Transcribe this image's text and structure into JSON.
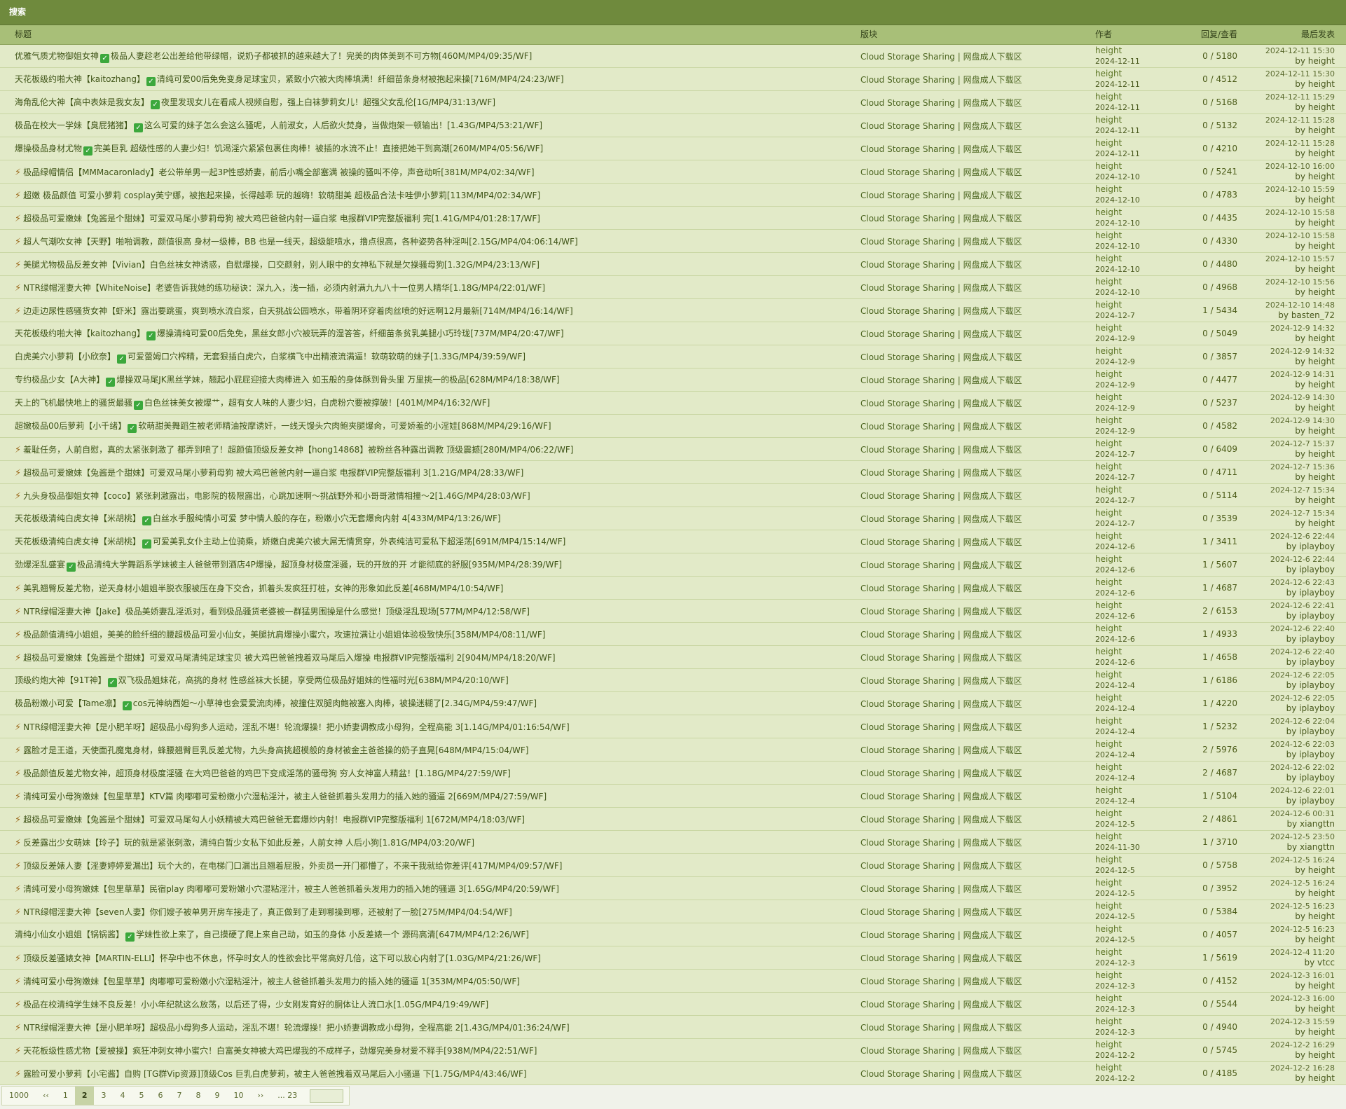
{
  "window_title": "搜索",
  "columns": {
    "title": "标题",
    "forum": "版块",
    "author": "作者",
    "stats": "回复/查看",
    "last": "最后发表"
  },
  "rows": [
    {
      "icon": "check",
      "prefix": "优雅气质尤物御姐女神",
      "title": "极品人妻趁老公出差给他带绿帽，说奶子都被抓的越来越大了！完美的肉体美到不可方物[460M/MP4/09:35/WF]",
      "forum": "Cloud Storage Sharing | 网盘成人下载区",
      "author": "height",
      "author_date": "2024-12-11",
      "stats": "0 / 5180",
      "last_date": "2024-12-11 15:30",
      "last_by": "by height"
    },
    {
      "icon": "check",
      "prefix": "天花板级约啪大神【kaitozhang】",
      "title": "清纯可爱00后免免变身足球宝贝，紧致小穴被大肉棒填满！纤细苗条身材被抱起来操[716M/MP4/24:23/WF]",
      "forum": "Cloud Storage Sharing | 网盘成人下载区",
      "author": "height",
      "author_date": "2024-12-11",
      "stats": "0 / 4512",
      "last_date": "2024-12-11 15:30",
      "last_by": "by height"
    },
    {
      "icon": "check",
      "prefix": "海角乱伦大神【高中表妹是我女友】",
      "title": "夜里发现女儿在看成人视频自慰，强上白袜萝莉女儿！超强父女乱伦[1G/MP4/31:13/WF]",
      "forum": "Cloud Storage Sharing | 网盘成人下载区",
      "author": "height",
      "author_date": "2024-12-11",
      "stats": "0 / 5168",
      "last_date": "2024-12-11 15:29",
      "last_by": "by height"
    },
    {
      "icon": "check",
      "prefix": "极品在校大一学妹【臭屁猪猪】",
      "title": "这么可爱的妹子怎么会这么骚呢，人前淑女，人后欲火焚身，当做炮架一顿输出！[1.43G/MP4/53:21/WF]",
      "forum": "Cloud Storage Sharing | 网盘成人下载区",
      "author": "height",
      "author_date": "2024-12-11",
      "stats": "0 / 5132",
      "last_date": "2024-12-11 15:28",
      "last_by": "by height"
    },
    {
      "icon": "check",
      "prefix": "爆操极品身材尤物",
      "title": "完美巨乳 超级性感的人妻少妇！饥渴淫穴紧紧包裹住肉棒！被插的水流不止！直接把她干到高潮[260M/MP4/05:56/WF]",
      "forum": "Cloud Storage Sharing | 网盘成人下载区",
      "author": "height",
      "author_date": "2024-12-11",
      "stats": "0 / 4210",
      "last_date": "2024-12-11 15:28",
      "last_by": "by height"
    },
    {
      "icon": "bolt",
      "prefix": "",
      "title": "极品绿帽情侣【MMMacaronlady】老公带单男一起3P性感娇妻，前后小嘴全部塞满 被操的骚叫不停，声音动听[381M/MP4/02:34/WF]",
      "forum": "Cloud Storage Sharing | 网盘成人下载区",
      "author": "height",
      "author_date": "2024-12-10",
      "stats": "0 / 5241",
      "last_date": "2024-12-10 16:00",
      "last_by": "by height"
    },
    {
      "icon": "bolt",
      "prefix": "",
      "title": "超嫩 极品颜值 可爱小萝莉 cosplay芙宁娜，被抱起来操，长得越乖 玩的越嗨！软萌甜美 超极品合法卡哇伊小萝莉[113M/MP4/02:34/WF]",
      "forum": "Cloud Storage Sharing | 网盘成人下载区",
      "author": "height",
      "author_date": "2024-12-10",
      "stats": "0 / 4783",
      "last_date": "2024-12-10 15:59",
      "last_by": "by height"
    },
    {
      "icon": "bolt",
      "prefix": "",
      "title": "超极品可爱嫩妹【兔酱是个甜妹】可爱双马尾小萝莉母狗 被大鸡巴爸爸内射一逼白浆 电报群VIP完整版福利 完[1.41G/MP4/01:28:17/WF]",
      "forum": "Cloud Storage Sharing | 网盘成人下载区",
      "author": "height",
      "author_date": "2024-12-10",
      "stats": "0 / 4435",
      "last_date": "2024-12-10 15:58",
      "last_by": "by height"
    },
    {
      "icon": "bolt",
      "prefix": "",
      "title": "超人气潮吹女神【天野】啪啪调教，颜值很高 身材一级棒，BB 也是一线天，超级能喷水，撸点很高，各种姿势各种淫叫[2.15G/MP4/04:06:14/WF]",
      "forum": "Cloud Storage Sharing | 网盘成人下载区",
      "author": "height",
      "author_date": "2024-12-10",
      "stats": "0 / 4330",
      "last_date": "2024-12-10 15:58",
      "last_by": "by height"
    },
    {
      "icon": "bolt",
      "prefix": "",
      "title": "美腿尤物极品反差女神【Vivian】白色丝袜女神诱惑，自慰爆操，口交颜射，别人眼中的女神私下就是欠操骚母狗[1.32G/MP4/23:13/WF]",
      "forum": "Cloud Storage Sharing | 网盘成人下载区",
      "author": "height",
      "author_date": "2024-12-10",
      "stats": "0 / 4480",
      "last_date": "2024-12-10 15:57",
      "last_by": "by height"
    },
    {
      "icon": "bolt",
      "prefix": "",
      "title": "NTR绿帽淫妻大神【WhiteNoise】老婆告诉我她的练功秘诀：深九入，浅一插，必须内射满九九八十一位男人精华[1.18G/MP4/22:01/WF]",
      "forum": "Cloud Storage Sharing | 网盘成人下载区",
      "author": "height",
      "author_date": "2024-12-10",
      "stats": "0 / 4968",
      "last_date": "2024-12-10 15:56",
      "last_by": "by height"
    },
    {
      "icon": "bolt",
      "prefix": "",
      "title": "边走边尿性感骚货女神【虾米】露出要跳蛋，爽到喷水流白浆，白天挑战公园喷水，带着阴环穿着肉丝喷的好远啊12月最新[714M/MP4/16:14/WF]",
      "forum": "Cloud Storage Sharing | 网盘成人下载区",
      "author": "height",
      "author_date": "2024-12-7",
      "stats": "1 / 5434",
      "last_date": "2024-12-10 14:48",
      "last_by": "by basten_72"
    },
    {
      "icon": "check",
      "prefix": "天花板级约啪大神【kaitozhang】",
      "title": "爆操清纯可爱00后免免，黑丝女郎小穴被玩弄的湿答答，纤细苗条贫乳美腿小巧玲珑[737M/MP4/20:47/WF]",
      "forum": "Cloud Storage Sharing | 网盘成人下载区",
      "author": "height",
      "author_date": "2024-12-9",
      "stats": "0 / 5049",
      "last_date": "2024-12-9 14:32",
      "last_by": "by height"
    },
    {
      "icon": "check",
      "prefix": "白虎美穴小萝莉【小欣奈】",
      "title": "可爱蕾姆口穴榨精，无套狠插白虎穴，白浆横飞中出精液流满逼！软萌软萌的妹子[1.33G/MP4/39:59/WF]",
      "forum": "Cloud Storage Sharing | 网盘成人下载区",
      "author": "height",
      "author_date": "2024-12-9",
      "stats": "0 / 3857",
      "last_date": "2024-12-9 14:32",
      "last_by": "by height"
    },
    {
      "icon": "check",
      "prefix": "专约极品少女【A大神】",
      "title": "爆操双马尾JK黑丝学妹，翘起小屁屁迎接大肉棒进入 如玉般的身体酥到骨头里 万里挑一的极品[628M/MP4/18:38/WF]",
      "forum": "Cloud Storage Sharing | 网盘成人下载区",
      "author": "height",
      "author_date": "2024-12-9",
      "stats": "0 / 4477",
      "last_date": "2024-12-9 14:31",
      "last_by": "by height"
    },
    {
      "icon": "check",
      "prefix": "天上的飞机最快地上的骚货最骚",
      "title": "白色丝袜美女被爆艹，超有女人味的人妻少妇，白虎粉穴要被撑破！[401M/MP4/16:32/WF]",
      "forum": "Cloud Storage Sharing | 网盘成人下载区",
      "author": "height",
      "author_date": "2024-12-9",
      "stats": "0 / 5237",
      "last_date": "2024-12-9 14:30",
      "last_by": "by height"
    },
    {
      "icon": "check",
      "prefix": "超嫩极品00后萝莉【小千绪】",
      "title": "软萌甜美舞蹈生被老师精油按摩诱奸，一线天馒头穴肉鲍夹腿爆肏，可爱娇羞的小淫娃[868M/MP4/29:16/WF]",
      "forum": "Cloud Storage Sharing | 网盘成人下载区",
      "author": "height",
      "author_date": "2024-12-9",
      "stats": "0 / 4582",
      "last_date": "2024-12-9 14:30",
      "last_by": "by height"
    },
    {
      "icon": "bolt",
      "prefix": "",
      "title": "羞耻任务，人前自慰，真的太紧张刺激了 都弄到喷了！超颜值顶级反差女神【hong14868】被粉丝各种露出调教 顶级震撼[280M/MP4/06:22/WF]",
      "forum": "Cloud Storage Sharing | 网盘成人下载区",
      "author": "height",
      "author_date": "2024-12-7",
      "stats": "0 / 6409",
      "last_date": "2024-12-7 15:37",
      "last_by": "by height"
    },
    {
      "icon": "bolt",
      "prefix": "",
      "title": "超极品可爱嫩妹【兔酱是个甜妹】可爱双马尾小萝莉母狗 被大鸡巴爸爸内射一逼白浆 电报群VIP完整版福利 3[1.21G/MP4/28:33/WF]",
      "forum": "Cloud Storage Sharing | 网盘成人下载区",
      "author": "height",
      "author_date": "2024-12-7",
      "stats": "0 / 4711",
      "last_date": "2024-12-7 15:36",
      "last_by": "by height"
    },
    {
      "icon": "bolt",
      "prefix": "",
      "title": "九头身极品御姐女神【coco】紧张刺激露出，电影院的极限露出，心跳加速啊～挑战野外和小哥哥激情相撞～2[1.46G/MP4/28:03/WF]",
      "forum": "Cloud Storage Sharing | 网盘成人下载区",
      "author": "height",
      "author_date": "2024-12-7",
      "stats": "0 / 5114",
      "last_date": "2024-12-7 15:34",
      "last_by": "by height"
    },
    {
      "icon": "check",
      "prefix": "天花板级清纯白虎女神【米胡桃】",
      "title": "白丝水手服纯情小可爱 梦中情人般的存在，粉嫩小穴无套爆肏内射 4[433M/MP4/13:26/WF]",
      "forum": "Cloud Storage Sharing | 网盘成人下载区",
      "author": "height",
      "author_date": "2024-12-7",
      "stats": "0 / 3539",
      "last_date": "2024-12-7 15:34",
      "last_by": "by height"
    },
    {
      "icon": "check",
      "prefix": "天花板级清纯白虎女神【米胡桃】",
      "title": "可爱美乳女仆主动上位骑乘，娇嫩白虎美穴被大屌无情贯穿，外表纯洁可爱私下超淫荡[691M/MP4/15:14/WF]",
      "forum": "Cloud Storage Sharing | 网盘成人下载区",
      "author": "height",
      "author_date": "2024-12-6",
      "stats": "1 / 3411",
      "last_date": "2024-12-6 22:44",
      "last_by": "by iplayboy"
    },
    {
      "icon": "check",
      "prefix": "劲爆淫乱盛宴",
      "title": "极品清纯大学舞蹈系学妹被主人爸爸带到酒店4P爆操，超顶身材极度淫骚，玩的开放的开 才能彻底的舒服[935M/MP4/28:39/WF]",
      "forum": "Cloud Storage Sharing | 网盘成人下载区",
      "author": "height",
      "author_date": "2024-12-6",
      "stats": "1 / 5607",
      "last_date": "2024-12-6 22:44",
      "last_by": "by iplayboy"
    },
    {
      "icon": "bolt",
      "prefix": "",
      "title": "美乳翘臀反差尤物，逆天身材小姐姐半脱衣服被压在身下交合，抓着头发疯狂打桩，女神的形象如此反差[468M/MP4/10:54/WF]",
      "forum": "Cloud Storage Sharing | 网盘成人下载区",
      "author": "height",
      "author_date": "2024-12-6",
      "stats": "1 / 4687",
      "last_date": "2024-12-6 22:43",
      "last_by": "by iplayboy"
    },
    {
      "icon": "bolt",
      "prefix": "",
      "title": "NTR绿帽淫妻大神【Jake】极品美娇妻乱淫派对，看到极品骚货老婆被一群猛男围操是什么感觉！顶级淫乱现场[577M/MP4/12:58/WF]",
      "forum": "Cloud Storage Sharing | 网盘成人下载区",
      "author": "height",
      "author_date": "2024-12-6",
      "stats": "2 / 6153",
      "last_date": "2024-12-6 22:41",
      "last_by": "by iplayboy"
    },
    {
      "icon": "bolt",
      "prefix": "",
      "title": "极品颜值清纯小姐姐，美美的脸纤细的腰超极品可爱小仙女，美腿抗肩爆操小蜜穴，攻速拉满让小姐姐体验极致快乐[358M/MP4/08:11/WF]",
      "forum": "Cloud Storage Sharing | 网盘成人下载区",
      "author": "height",
      "author_date": "2024-12-6",
      "stats": "1 / 4933",
      "last_date": "2024-12-6 22:40",
      "last_by": "by iplayboy"
    },
    {
      "icon": "bolt",
      "prefix": "",
      "title": "超极品可爱嫩妹【兔酱是个甜妹】可爱双马尾清纯足球宝贝 被大鸡巴爸爸拽着双马尾后入爆操 电报群VIP完整版福利 2[904M/MP4/18:20/WF]",
      "forum": "Cloud Storage Sharing | 网盘成人下载区",
      "author": "height",
      "author_date": "2024-12-6",
      "stats": "1 / 4658",
      "last_date": "2024-12-6 22:40",
      "last_by": "by iplayboy"
    },
    {
      "icon": "check",
      "prefix": "顶级约炮大神【91T神】",
      "title": "双飞极品姐妹花，高挑的身材 性感丝袜大长腿，享受两位极品好姐妹的性福时光[638M/MP4/20:10/WF]",
      "forum": "Cloud Storage Sharing | 网盘成人下载区",
      "author": "height",
      "author_date": "2024-12-4",
      "stats": "1 / 6186",
      "last_date": "2024-12-6 22:05",
      "last_by": "by iplayboy"
    },
    {
      "icon": "check",
      "prefix": "极品粉嫩小可爱【Tame凛】",
      "title": "cos元神纳西妲～小草神也会爱爱流肉棒，被撞住双腿肉鲍被塞入肉棒，被操迷糊了[2.34G/MP4/59:47/WF]",
      "forum": "Cloud Storage Sharing | 网盘成人下载区",
      "author": "height",
      "author_date": "2024-12-4",
      "stats": "1 / 4220",
      "last_date": "2024-12-6 22:05",
      "last_by": "by iplayboy"
    },
    {
      "icon": "bolt",
      "prefix": "",
      "title": "NTR绿帽淫妻大神【是小肥羊呀】超极品小母狗多人运动，淫乱不堪！轮流爆操！把小娇妻调教成小母狗，全程高能 3[1.14G/MP4/01:16:54/WF]",
      "forum": "Cloud Storage Sharing | 网盘成人下载区",
      "author": "height",
      "author_date": "2024-12-4",
      "stats": "1 / 5232",
      "last_date": "2024-12-6 22:04",
      "last_by": "by iplayboy"
    },
    {
      "icon": "bolt",
      "prefix": "",
      "title": "露脸才是王道，天使面孔魔鬼身材，蜂腰翘臀巨乳反差尤物，九头身高挑超模般的身材被金主爸爸操的奶子直晃[648M/MP4/15:04/WF]",
      "forum": "Cloud Storage Sharing | 网盘成人下载区",
      "author": "height",
      "author_date": "2024-12-4",
      "stats": "2 / 5976",
      "last_date": "2024-12-6 22:03",
      "last_by": "by iplayboy"
    },
    {
      "icon": "bolt",
      "prefix": "",
      "title": "极品颜值反差尤物女神，超顶身材极度淫骚 在大鸡巴爸爸的鸡巴下变成淫荡的骚母狗 穷人女神富人精盆！[1.18G/MP4/27:59/WF]",
      "forum": "Cloud Storage Sharing | 网盘成人下载区",
      "author": "height",
      "author_date": "2024-12-4",
      "stats": "2 / 4687",
      "last_date": "2024-12-6 22:02",
      "last_by": "by iplayboy"
    },
    {
      "icon": "bolt",
      "prefix": "",
      "title": "清纯可爱小母狗嫩妹【包里草草】KTV篇 肉嘟嘟可爱粉嫩小穴湿粘淫汁，被主人爸爸抓着头发用力的插入她的骚逼 2[669M/MP4/27:59/WF]",
      "forum": "Cloud Storage Sharing | 网盘成人下载区",
      "author": "height",
      "author_date": "2024-12-4",
      "stats": "1 / 5104",
      "last_date": "2024-12-6 22:01",
      "last_by": "by iplayboy"
    },
    {
      "icon": "bolt",
      "prefix": "",
      "title": "超极品可爱嫩妹【兔酱是个甜妹】可爱双马尾勾人小妖精被大鸡巴爸爸无套爆炒内射！电报群VIP完整版福利 1[672M/MP4/18:03/WF]",
      "forum": "Cloud Storage Sharing | 网盘成人下载区",
      "author": "height",
      "author_date": "2024-12-5",
      "stats": "2 / 4861",
      "last_date": "2024-12-6 00:31",
      "last_by": "by xiangttn"
    },
    {
      "icon": "bolt",
      "prefix": "",
      "title": "反差露出少女萌妹【玲子】玩的就是紧张刺激，清纯白皙少女私下如此反差，人前女神 人后小狗[1.81G/MP4/03:20/WF]",
      "forum": "Cloud Storage Sharing | 网盘成人下载区",
      "author": "height",
      "author_date": "2024-11-30",
      "stats": "1 / 3710",
      "last_date": "2024-12-5 23:50",
      "last_by": "by xiangttn"
    },
    {
      "icon": "bolt",
      "prefix": "",
      "title": "顶级反差婊人妻【淫妻婷婷爱漏出】玩个大的，在电梯门口漏出且翘着屁股，外卖员一开门都懵了，不来干我就给你差评[417M/MP4/09:57/WF]",
      "forum": "Cloud Storage Sharing | 网盘成人下载区",
      "author": "height",
      "author_date": "2024-12-5",
      "stats": "0 / 5758",
      "last_date": "2024-12-5 16:24",
      "last_by": "by height"
    },
    {
      "icon": "bolt",
      "prefix": "",
      "title": "清纯可爱小母狗嫩妹【包里草草】民宿play 肉嘟嘟可爱粉嫩小穴湿粘淫汁，被主人爸爸抓着头发用力的插入她的骚逼 3[1.65G/MP4/20:59/WF]",
      "forum": "Cloud Storage Sharing | 网盘成人下载区",
      "author": "height",
      "author_date": "2024-12-5",
      "stats": "0 / 3952",
      "last_date": "2024-12-5 16:24",
      "last_by": "by height"
    },
    {
      "icon": "bolt",
      "prefix": "",
      "title": "NTR绿帽淫妻大神【seven人妻】你们嫂子被单男开房车接走了，真正做到了走到哪操到哪，还被射了一脸[275M/MP4/04:54/WF]",
      "forum": "Cloud Storage Sharing | 网盘成人下载区",
      "author": "height",
      "author_date": "2024-12-5",
      "stats": "0 / 5384",
      "last_date": "2024-12-5 16:23",
      "last_by": "by height"
    },
    {
      "icon": "check",
      "prefix": "清纯小仙女小姐姐【锅锅酱】",
      "title": "学妹性欲上来了，自己摸硬了爬上来自己动，如玉的身体 小反差婊一个 源码高清[647M/MP4/12:26/WF]",
      "forum": "Cloud Storage Sharing | 网盘成人下载区",
      "author": "height",
      "author_date": "2024-12-5",
      "stats": "0 / 4057",
      "last_date": "2024-12-5 16:23",
      "last_by": "by height"
    },
    {
      "icon": "bolt",
      "prefix": "",
      "title": "顶级反差骚婊女神【MARTIN-ELLI】怀孕中也不休息，怀孕时女人的性欲会比平常高好几倍，这下可以放心内射了[1.03G/MP4/21:26/WF]",
      "forum": "Cloud Storage Sharing | 网盘成人下载区",
      "author": "height",
      "author_date": "2024-12-3",
      "stats": "1 / 5619",
      "last_date": "2024-12-4 11:20",
      "last_by": "by vtcc"
    },
    {
      "icon": "bolt",
      "prefix": "",
      "title": "清纯可爱小母狗嫩妹【包里草草】肉嘟嘟可爱粉嫩小穴湿粘淫汁，被主人爸爸抓着头发用力的插入她的骚逼 1[353M/MP4/05:50/WF]",
      "forum": "Cloud Storage Sharing | 网盘成人下载区",
      "author": "height",
      "author_date": "2024-12-3",
      "stats": "0 / 4152",
      "last_date": "2024-12-3 16:01",
      "last_by": "by height"
    },
    {
      "icon": "bolt",
      "prefix": "",
      "title": "极品在校清纯学生妹不良反差！小小年纪就这么放荡，以后还了得，少女刚发育好的胴体让人流口水[1.05G/MP4/19:49/WF]",
      "forum": "Cloud Storage Sharing | 网盘成人下载区",
      "author": "height",
      "author_date": "2024-12-3",
      "stats": "0 / 5544",
      "last_date": "2024-12-3 16:00",
      "last_by": "by height"
    },
    {
      "icon": "bolt",
      "prefix": "",
      "title": "NTR绿帽淫妻大神【是小肥羊呀】超极品小母狗多人运动，淫乱不堪！轮流爆操！把小娇妻调教成小母狗，全程高能 2[1.43G/MP4/01:36:24/WF]",
      "forum": "Cloud Storage Sharing | 网盘成人下载区",
      "author": "height",
      "author_date": "2024-12-3",
      "stats": "0 / 4940",
      "last_date": "2024-12-3 15:59",
      "last_by": "by height"
    },
    {
      "icon": "bolt",
      "prefix": "",
      "title": "天花板级性感尤物【爱被操】疯狂冲刺女神小蜜穴！白富美女神被大鸡巴爆我的不成样子，劲爆完美身材爱不释手[938M/MP4/22:51/WF]",
      "forum": "Cloud Storage Sharing | 网盘成人下载区",
      "author": "height",
      "author_date": "2024-12-2",
      "stats": "0 / 5745",
      "last_date": "2024-12-2 16:29",
      "last_by": "by height"
    },
    {
      "icon": "bolt",
      "prefix": "",
      "title": "露脸可爱小萝莉【小宅酱】自购 [TG群Vip资源]顶级Cos 巨乳白虎萝莉，被主人爸爸拽着双马尾后入小骚逼 下[1.75G/MP4/43:46/WF]",
      "forum": "Cloud Storage Sharing | 网盘成人下载区",
      "author": "height",
      "author_date": "2024-12-2",
      "stats": "0 / 4185",
      "last_date": "2024-12-2 16:28",
      "last_by": "by height"
    }
  ],
  "pager": {
    "total": "1000",
    "prev": "‹‹",
    "pages": [
      "1",
      "2",
      "3",
      "4",
      "5",
      "6",
      "7",
      "8",
      "9",
      "10"
    ],
    "current": "2",
    "next": "››",
    "last": "... 23"
  },
  "icons": {
    "check": "check-badge-icon",
    "bolt": "bolt-icon"
  },
  "colors": {
    "titlebar": "#6f8a3d",
    "header": "#a8bf78",
    "row": "#e2eac8"
  }
}
